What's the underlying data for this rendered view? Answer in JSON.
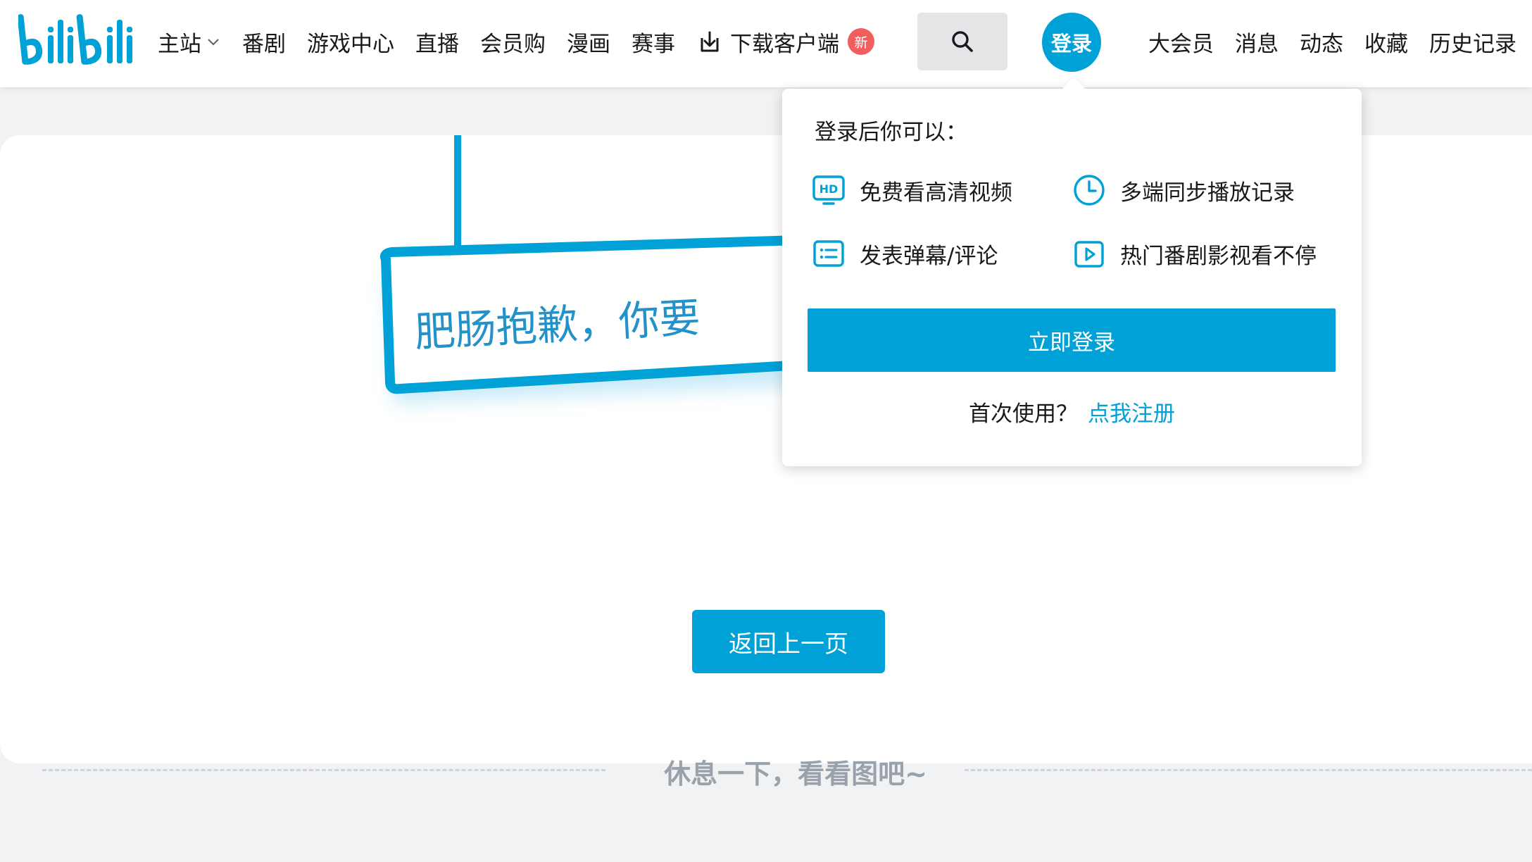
{
  "header": {
    "logo_text": "bilibili",
    "nav": [
      {
        "label": "主站",
        "has_dropdown": true
      },
      {
        "label": "番剧"
      },
      {
        "label": "游戏中心"
      },
      {
        "label": "直播"
      },
      {
        "label": "会员购"
      },
      {
        "label": "漫画"
      },
      {
        "label": "赛事"
      }
    ],
    "download_label": "下载客户端",
    "new_badge": "新",
    "login_avatar_label": "登录",
    "right_nav": [
      "大会员",
      "消息",
      "动态",
      "收藏",
      "历史记录"
    ]
  },
  "error_page": {
    "sign_text_visible": "肥肠抱歉，你要",
    "back_button": "返回上一页",
    "divider_text": "休息一下，看看图吧~"
  },
  "login_popover": {
    "title": "登录后你可以：",
    "benefits": [
      {
        "icon": "hd-icon",
        "label": "免费看高清视频"
      },
      {
        "icon": "clock-icon",
        "label": "多端同步播放记录"
      },
      {
        "icon": "list-icon",
        "label": "发表弹幕/评论"
      },
      {
        "icon": "play-icon",
        "label": "热门番剧影视看不停"
      }
    ],
    "login_button": "立即登录",
    "first_use_text": "首次使用？",
    "register_link": "点我注册"
  },
  "colors": {
    "accent": "#00a1d6",
    "badge": "#f25d5d",
    "page_bg": "#f1f2f3",
    "muted_text": "#99a2aa"
  }
}
